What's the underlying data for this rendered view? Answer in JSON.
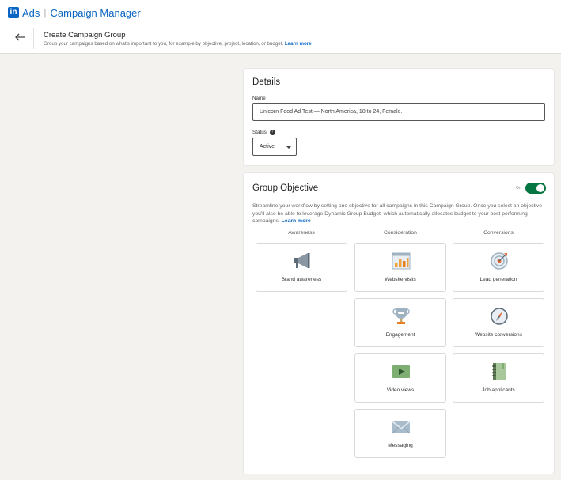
{
  "app": {
    "logo_text": "in",
    "brand_ads": "Ads",
    "separator": "|",
    "brand_name": "Campaign Manager"
  },
  "header": {
    "title": "Create Campaign Group",
    "subtitle": "Group your campaigns based on what's important to you, for example by objective, project, location, or budget.",
    "learn_more": "Learn more"
  },
  "details": {
    "title": "Details",
    "name_label": "Name",
    "name_value": "Unicorn Food Ad Test — North America, 18 to 24, Female.",
    "status_label": "Status",
    "help_glyph": "?",
    "status_value": "Active"
  },
  "objective": {
    "title": "Group Objective",
    "toggle_label": "On",
    "toggle_on": true,
    "description": "Streamline your workflow by setting one objective for all campaigns in this Campaign Group. Once you select an objective you'll also be able to leverage Dynamic Group Budget, which automatically allocates budget to your best performing campaigns.",
    "learn_more": "Learn more",
    "columns": [
      "Awareness",
      "Consideration",
      "Conversions"
    ],
    "tiles": {
      "brand_awareness": "Brand awareness",
      "website_visits": "Website visits",
      "engagement": "Engagement",
      "video_views": "Video views",
      "messaging": "Messaging",
      "lead_generation": "Lead generation",
      "website_conversions": "Website conversions",
      "job_applicants": "Job applicants"
    }
  },
  "colors": {
    "brand": "#0a66c2",
    "toggle_on": "#057642",
    "background": "#f3f2ef"
  }
}
